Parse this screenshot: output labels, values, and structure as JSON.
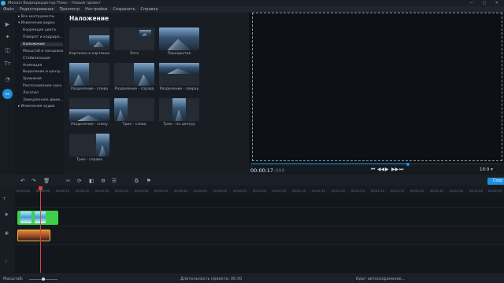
{
  "window": {
    "title": "Movavi Видеоредактор Плюс - Новый проект",
    "controls": "— ▢ ✕"
  },
  "menu": [
    "Файл",
    "Редактирование",
    "Просмотр",
    "Настройки",
    "Сохранить",
    "Справка"
  ],
  "toolstrip": [
    {
      "name": "import-icon",
      "glyph": "▶"
    },
    {
      "name": "magic-wand-icon",
      "glyph": "✦"
    },
    {
      "name": "filters-icon",
      "glyph": "◫"
    },
    {
      "name": "titles-icon",
      "glyph": "Tт"
    },
    {
      "name": "transitions-icon",
      "glyph": "◔"
    },
    {
      "name": "more-tools-icon",
      "glyph": "✂"
    }
  ],
  "categories": [
    {
      "label": "▸ Все инструменты"
    },
    {
      "label": "▾ Изменение видео"
    },
    {
      "label": "Коррекция цвета"
    },
    {
      "label": "Поворот и кадриро..."
    },
    {
      "label": "Наложение",
      "selected": true
    },
    {
      "label": "Масштаб и панорама"
    },
    {
      "label": "Стабилизация"
    },
    {
      "label": "Анимация"
    },
    {
      "label": "Выделение и цензу..."
    },
    {
      "label": "Хромакей"
    },
    {
      "label": "Распознавание сцен"
    },
    {
      "label": "Логотип"
    },
    {
      "label": "Замедленное движ..."
    },
    {
      "label": "▸ Изменение аудио"
    }
  ],
  "gallery": {
    "title": "Наложение",
    "items": [
      "Картинка в картинке",
      "Лого",
      "Перекрытие",
      "Разделение - слева",
      "Разделение - справа",
      "Разделение - сверху",
      "Разделение - снизу",
      "Трио - слева",
      "Трио - по центру",
      "Трио - справа"
    ]
  },
  "player": {
    "timecode_main": "00:00:17",
    "timecode_frac": ".000",
    "controls": [
      "⏮",
      "◀◀",
      "▶",
      "▶▶",
      "⏭"
    ],
    "aspect": "16:9 ▾",
    "progress": 0.62
  },
  "timeline_tools": [
    "↶",
    "↷",
    "🗑",
    "✂",
    "⟳",
    "◧",
    "⚙",
    "☰",
    "⧉",
    "⚑"
  ],
  "export_label": "Сохр",
  "ruler": [
    "00:00:00",
    "00:00:05",
    "00:00:10",
    "00:00:15",
    "00:00:20",
    "00:00:25",
    "00:00:30",
    "00:00:35",
    "00:00:40",
    "00:00:45",
    "00:00:50",
    "00:00:55",
    "00:01:00",
    "00:01:05",
    "00:01:10",
    "00:01:15",
    "00:01:20",
    "00:01:25",
    "00:01:30",
    "00:01:35",
    "00:01:40",
    "00:01:45",
    "00:01:50",
    "00:01:55",
    "00:02:00"
  ],
  "status": {
    "zoom_label": "Масштаб:",
    "duration": "Длительность проекта: 00:30",
    "autosave": "Идет автосохранение..."
  },
  "colors": {
    "accent": "#1e8fde",
    "playhead": "#e0443c",
    "clip_green": "#3ed04a",
    "clip_border": "#f5b53a"
  }
}
